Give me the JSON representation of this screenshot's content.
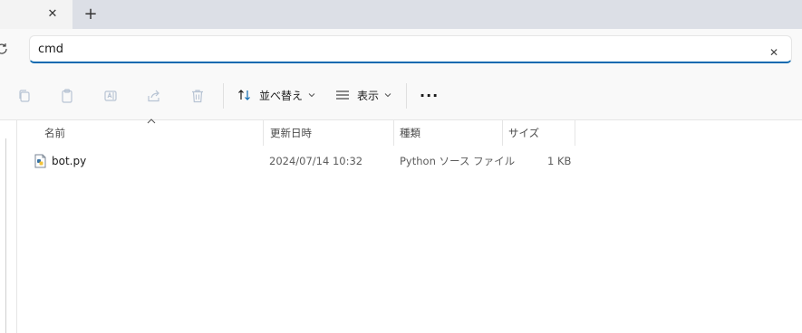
{
  "tabs": {
    "close_glyph": "✕",
    "new_tab_glyph": "+"
  },
  "search": {
    "value": "cmd",
    "clear_glyph": "✕"
  },
  "toolbar": {
    "sort_label": "並べ替え",
    "view_label": "表示",
    "more_label": "···",
    "icons": [
      "copy-icon",
      "paste-icon",
      "rename-icon",
      "share-icon",
      "delete-icon"
    ],
    "accent_color": "#0e6ab0"
  },
  "table": {
    "columns": [
      "名前",
      "更新日時",
      "種類",
      "サイズ"
    ],
    "rows": [
      {
        "name": "bot.py",
        "modified": "2024/07/14 10:32",
        "type": "Python ソース ファイル",
        "size": "1 KB"
      }
    ]
  }
}
